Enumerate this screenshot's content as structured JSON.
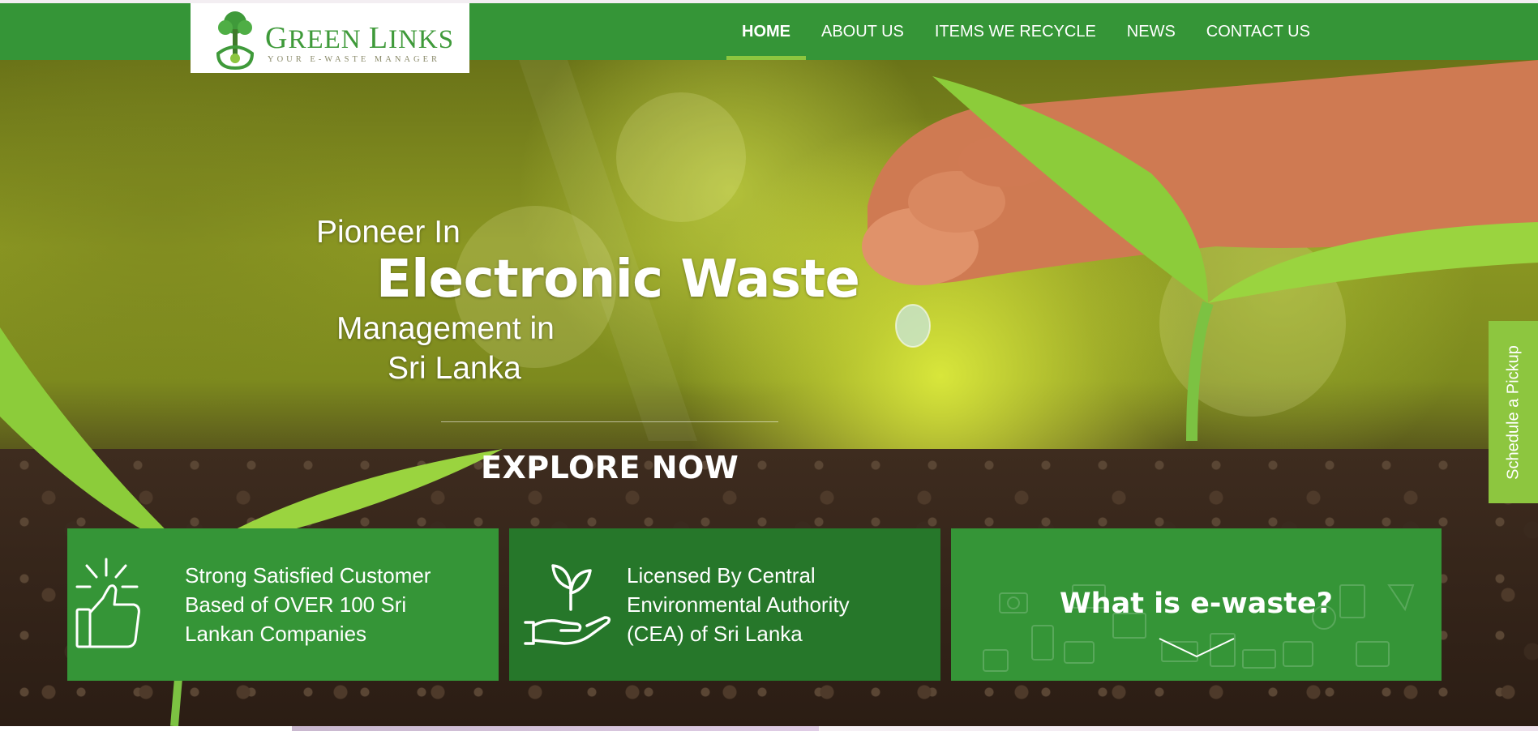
{
  "brand": {
    "name_first": "G",
    "name_rest": "REEN ",
    "name_second": "L",
    "name_second_rest": "INKS",
    "tagline": "YOUR E-WASTE MANAGER",
    "color": "#359537",
    "accent": "#8dc63f"
  },
  "nav": {
    "items": [
      {
        "label": "HOME",
        "active": true
      },
      {
        "label": "ABOUT US",
        "active": false
      },
      {
        "label": "ITEMS WE RECYCLE",
        "active": false
      },
      {
        "label": "NEWS",
        "active": false
      },
      {
        "label": "CONTACT US",
        "active": false
      }
    ]
  },
  "hero": {
    "line1": "Pioneer In",
    "line2": "Electronic Waste",
    "line3": "Management in",
    "line4": "Sri Lanka",
    "cta": "EXPLORE NOW"
  },
  "schedule_tab": {
    "label": "Schedule a Pickup"
  },
  "features": [
    {
      "icon": "thumbs-up-icon",
      "lines": [
        "Strong Satisfied Customer",
        "Based of OVER 100 Sri",
        "Lankan Companies"
      ]
    },
    {
      "icon": "plant-in-hand-icon",
      "lines": [
        "Licensed By Central",
        "Environmental Authority",
        "(CEA) of Sri Lanka"
      ]
    },
    {
      "icon": "chevron-down-icon",
      "title": "What is e-waste?"
    }
  ]
}
